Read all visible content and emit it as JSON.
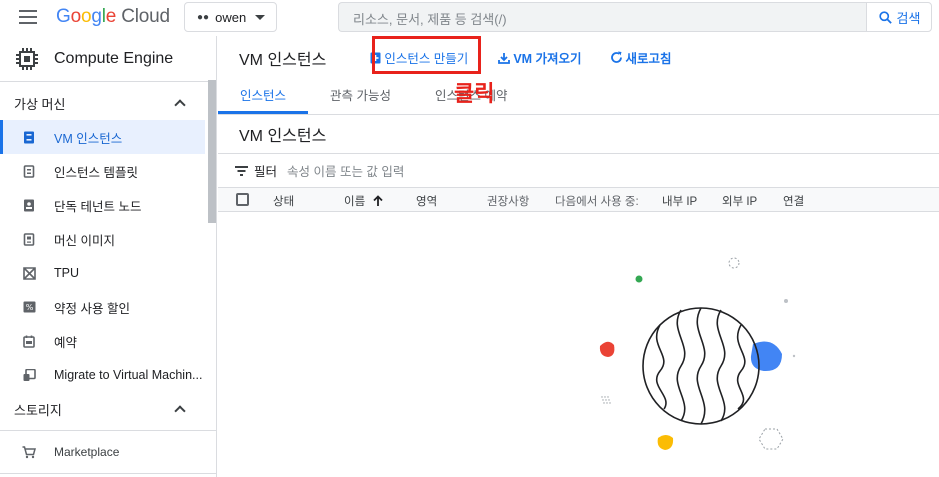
{
  "topbar": {
    "logo": {
      "g": "G",
      "o1": "o",
      "o2": "o",
      "g2": "g",
      "l": "l",
      "e": "e",
      "cloud": " Cloud"
    },
    "project_name": "owen",
    "search_placeholder": "리소스, 문서, 제품 등 검색(/)",
    "search_button": "검색"
  },
  "sidebar": {
    "product_title": "Compute Engine",
    "sections": [
      {
        "label": "가상 머신"
      },
      {
        "label": "스토리지"
      }
    ],
    "items": [
      {
        "label": "VM 인스턴스",
        "icon": "vm-instance-icon"
      },
      {
        "label": "인스턴스 템플릿",
        "icon": "instance-template-icon"
      },
      {
        "label": "단독 테넌트 노드",
        "icon": "sole-tenant-icon"
      },
      {
        "label": "머신 이미지",
        "icon": "machine-image-icon"
      },
      {
        "label": "TPU",
        "icon": "tpu-icon"
      },
      {
        "label": "약정 사용 할인",
        "icon": "discount-icon"
      },
      {
        "label": "예약",
        "icon": "calendar-icon"
      },
      {
        "label": "Migrate to Virtual Machin...",
        "icon": "migrate-icon"
      }
    ],
    "marketplace": "Marketplace"
  },
  "main": {
    "page_title": "VM 인스턴스",
    "actions": {
      "create": "인스턴스 만들기",
      "import": "VM 가져오기",
      "refresh": "새로고침"
    },
    "annotation": "클릭",
    "tabs": [
      "인스턴스",
      "관측 가능성",
      "인스턴스 예약"
    ],
    "subtitle": "VM 인스턴스",
    "filter": {
      "label": "필터",
      "placeholder": "속성 이름 또는 값 입력"
    },
    "columns": [
      "상태",
      "이름",
      "영역",
      "권장사항",
      "다음에서 사용 중:",
      "내부 IP",
      "외부 IP",
      "연결"
    ]
  },
  "colors": {
    "accent": "#1a73e8",
    "annotation": "#e8221b"
  }
}
